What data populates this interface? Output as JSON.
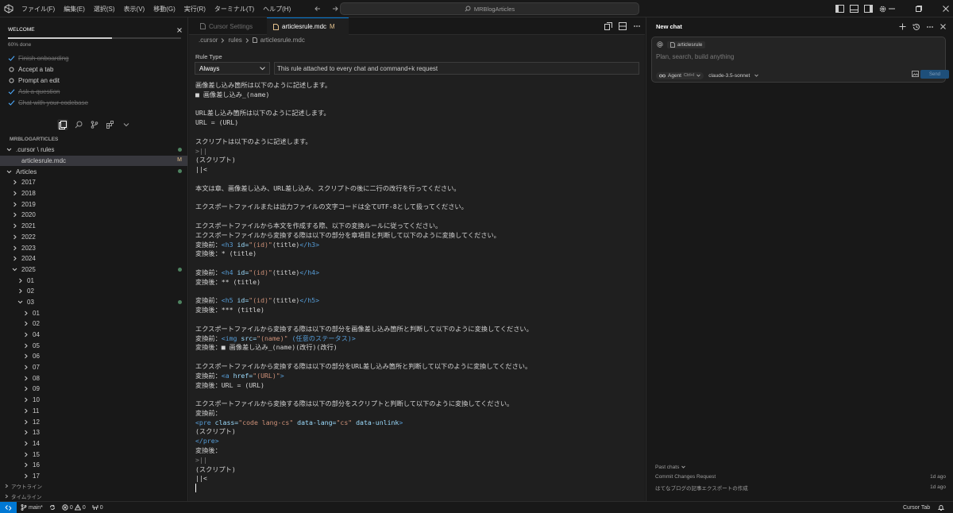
{
  "titlebar": {
    "menu": [
      "ファイル(F)",
      "編集(E)",
      "選択(S)",
      "表示(V)",
      "移動(G)",
      "実行(R)",
      "ターミナル(T)",
      "ヘルプ(H)"
    ],
    "search_text": "MRBlogArticles"
  },
  "welcome": {
    "title": "WELCOME",
    "progress_percent": 60,
    "progress_text": "60% done",
    "items": [
      {
        "label": "Finish onboarding",
        "done": true
      },
      {
        "label": "Accept a tab",
        "done": false
      },
      {
        "label": "Prompt an edit",
        "done": false
      },
      {
        "label": "Ask a question",
        "done": true
      },
      {
        "label": "Chat with your codebase",
        "done": true
      }
    ]
  },
  "explorer": {
    "title": "MRBLOGARTICLES",
    "rows": [
      {
        "label": ".cursor \\ rules",
        "indent": 1,
        "chevron": "down",
        "dot": true
      },
      {
        "label": "articlesrule.mdc",
        "indent": 2,
        "chevron": "",
        "mark": "M",
        "selected": true
      },
      {
        "label": "Articles",
        "indent": 1,
        "chevron": "down",
        "dot": true
      },
      {
        "label": "2017",
        "indent": 2,
        "chevron": "right"
      },
      {
        "label": "2018",
        "indent": 2,
        "chevron": "right"
      },
      {
        "label": "2019",
        "indent": 2,
        "chevron": "right"
      },
      {
        "label": "2020",
        "indent": 2,
        "chevron": "right"
      },
      {
        "label": "2021",
        "indent": 2,
        "chevron": "right"
      },
      {
        "label": "2022",
        "indent": 2,
        "chevron": "right"
      },
      {
        "label": "2023",
        "indent": 2,
        "chevron": "right"
      },
      {
        "label": "2024",
        "indent": 2,
        "chevron": "right"
      },
      {
        "label": "2025",
        "indent": 2,
        "chevron": "down",
        "dot": true
      },
      {
        "label": "01",
        "indent": 3,
        "chevron": "right"
      },
      {
        "label": "02",
        "indent": 3,
        "chevron": "right"
      },
      {
        "label": "03",
        "indent": 3,
        "chevron": "down",
        "dot": true
      },
      {
        "label": "01",
        "indent": 4,
        "chevron": "right"
      },
      {
        "label": "02",
        "indent": 4,
        "chevron": "right"
      },
      {
        "label": "04",
        "indent": 4,
        "chevron": "right"
      },
      {
        "label": "05",
        "indent": 4,
        "chevron": "right"
      },
      {
        "label": "06",
        "indent": 4,
        "chevron": "right"
      },
      {
        "label": "07",
        "indent": 4,
        "chevron": "right"
      },
      {
        "label": "08",
        "indent": 4,
        "chevron": "right"
      },
      {
        "label": "09",
        "indent": 4,
        "chevron": "right"
      },
      {
        "label": "10",
        "indent": 4,
        "chevron": "right"
      },
      {
        "label": "11",
        "indent": 4,
        "chevron": "right"
      },
      {
        "label": "12",
        "indent": 4,
        "chevron": "right"
      },
      {
        "label": "13",
        "indent": 4,
        "chevron": "right"
      },
      {
        "label": "14",
        "indent": 4,
        "chevron": "right"
      },
      {
        "label": "15",
        "indent": 4,
        "chevron": "right"
      },
      {
        "label": "16",
        "indent": 4,
        "chevron": "right"
      },
      {
        "label": "17",
        "indent": 4,
        "chevron": "right"
      }
    ],
    "footer": [
      "アウトライン",
      "タイムライン"
    ]
  },
  "editor": {
    "tabs": [
      {
        "label": "Cursor Settings",
        "active": false
      },
      {
        "label": "articlesrule.mdc",
        "active": true,
        "modified": "M"
      }
    ],
    "breadcrumb": [
      ".cursor",
      "rules",
      "articlesrule.mdc"
    ],
    "rule_type_label": "Rule Type",
    "rule_type_value": "Always",
    "rule_description": "This rule attached to every chat and command+k request",
    "code_lines": [
      [
        [
          "画像差し込み箇所は以下のように記述します。",
          "t"
        ]
      ],
      [
        [
          "■ 画像差し込み_(name)",
          "t"
        ]
      ],
      [
        [
          "",
          "t"
        ]
      ],
      [
        [
          "URL差し込み箇所は以下のように記述します。",
          "t"
        ]
      ],
      [
        [
          "URL = (URL)",
          "t"
        ]
      ],
      [
        [
          "",
          "t"
        ]
      ],
      [
        [
          "スクリプトは以下のように記述します。",
          "t"
        ]
      ],
      [
        [
          ">||",
          "muted"
        ]
      ],
      [
        [
          "(スクリプト)",
          "t"
        ]
      ],
      [
        [
          "||<",
          "t"
        ]
      ],
      [
        [
          "",
          "t"
        ]
      ],
      [
        [
          "本文は章、画像差し込み、URL差し込み、スクリプトの後に二行の改行を行ってください。",
          "t"
        ]
      ],
      [
        [
          "",
          "t"
        ]
      ],
      [
        [
          "エクスポートファイルまたは出力ファイルの文字コードは全てUTF-8として扱ってください。",
          "t"
        ]
      ],
      [
        [
          "",
          "t"
        ]
      ],
      [
        [
          "エクスポートファイルから本文を作成する際、以下の変換ルールに従ってください。",
          "t"
        ]
      ],
      [
        [
          "エクスポートファイルから変換する際は以下の部分を章項目と判断して以下のように変換してください。",
          "t"
        ]
      ],
      [
        [
          "変換前：",
          "t"
        ],
        [
          "<h3 ",
          "tag"
        ],
        [
          "id=",
          "attr"
        ],
        [
          "\"(id)\"",
          "str"
        ],
        [
          "(title)",
          "t"
        ],
        [
          "</h3>",
          "tag"
        ]
      ],
      [
        [
          "変換後：* (title)",
          "t"
        ]
      ],
      [
        [
          "",
          "t"
        ]
      ],
      [
        [
          "変換前：",
          "t"
        ],
        [
          "<h4 ",
          "tag"
        ],
        [
          "id=",
          "attr"
        ],
        [
          "\"(id)\"",
          "str"
        ],
        [
          "(title)",
          "t"
        ],
        [
          "</h4>",
          "tag"
        ]
      ],
      [
        [
          "変換後：** (title)",
          "t"
        ]
      ],
      [
        [
          "",
          "t"
        ]
      ],
      [
        [
          "変換前：",
          "t"
        ],
        [
          "<h5 ",
          "tag"
        ],
        [
          "id=",
          "attr"
        ],
        [
          "\"(id)\"",
          "str"
        ],
        [
          "(title)",
          "t"
        ],
        [
          "</h5>",
          "tag"
        ]
      ],
      [
        [
          "変換後：*** (title)",
          "t"
        ]
      ],
      [
        [
          "",
          "t"
        ]
      ],
      [
        [
          "エクスポートファイルから変換する際は以下の部分を画像差し込み箇所と判断して以下のように変換してください。",
          "t"
        ]
      ],
      [
        [
          "変換前：",
          "t"
        ],
        [
          "<img ",
          "tag"
        ],
        [
          "src=",
          "attr"
        ],
        [
          "\"(name)\"",
          "str"
        ],
        [
          " (任意のステータス)>",
          "tag"
        ]
      ],
      [
        [
          "変換後：■ 画像差し込み_(name)(改行)(改行)",
          "t"
        ]
      ],
      [
        [
          "",
          "t"
        ]
      ],
      [
        [
          "エクスポートファイルから変換する際は以下の部分をURL差し込み箇所と判断して以下のように変換してください。",
          "t"
        ]
      ],
      [
        [
          "変換前：",
          "t"
        ],
        [
          "<a ",
          "tag"
        ],
        [
          "href=",
          "attr"
        ],
        [
          "\"(URL)\"",
          "str"
        ],
        [
          ">",
          "tag"
        ]
      ],
      [
        [
          "変換後：URL = (URL)",
          "t"
        ]
      ],
      [
        [
          "",
          "t"
        ]
      ],
      [
        [
          "エクスポートファイルから変換する際は以下の部分をスクリプトと判断して以下のように変換してください。",
          "t"
        ]
      ],
      [
        [
          "変換前：",
          "t"
        ]
      ],
      [
        [
          "<pre ",
          "tag"
        ],
        [
          "class=",
          "attr"
        ],
        [
          "\"code lang-cs\"",
          "str"
        ],
        [
          " data-lang=",
          "attr"
        ],
        [
          "\"cs\"",
          "str"
        ],
        [
          " data-unlink",
          "attr"
        ],
        [
          ">",
          "tag"
        ]
      ],
      [
        [
          "(スクリプト)",
          "t"
        ]
      ],
      [
        [
          "</pre>",
          "tag"
        ]
      ],
      [
        [
          "変換後：",
          "t"
        ]
      ],
      [
        [
          ">||",
          "muted"
        ]
      ],
      [
        [
          "(スクリプト)",
          "t"
        ]
      ],
      [
        [
          "||<",
          "t"
        ]
      ],
      [
        [
          "",
          "cursor"
        ]
      ]
    ]
  },
  "chat": {
    "title": "New chat",
    "context_file": "articlesrule",
    "placeholder": "Plan, search, build anything",
    "agent_label": "Agent",
    "agent_shortcut": "Ctrl+I",
    "model": "claude-3.5-sonnet",
    "send_label": "Send",
    "past_chats_label": "Past chats",
    "past_chats": [
      {
        "title": "Commit Changes Request",
        "time": "1d ago"
      },
      {
        "title": "はてなブログの記事エクスポートの作成",
        "time": "1d ago"
      }
    ]
  },
  "statusbar": {
    "branch": "main*",
    "errors": "0",
    "warnings": "0",
    "ports": "0",
    "cursor_tab": "Cursor Tab"
  },
  "colors": {
    "accent": "#0078d4",
    "modified": "#e2c08d",
    "added_dot": "#73c991"
  }
}
